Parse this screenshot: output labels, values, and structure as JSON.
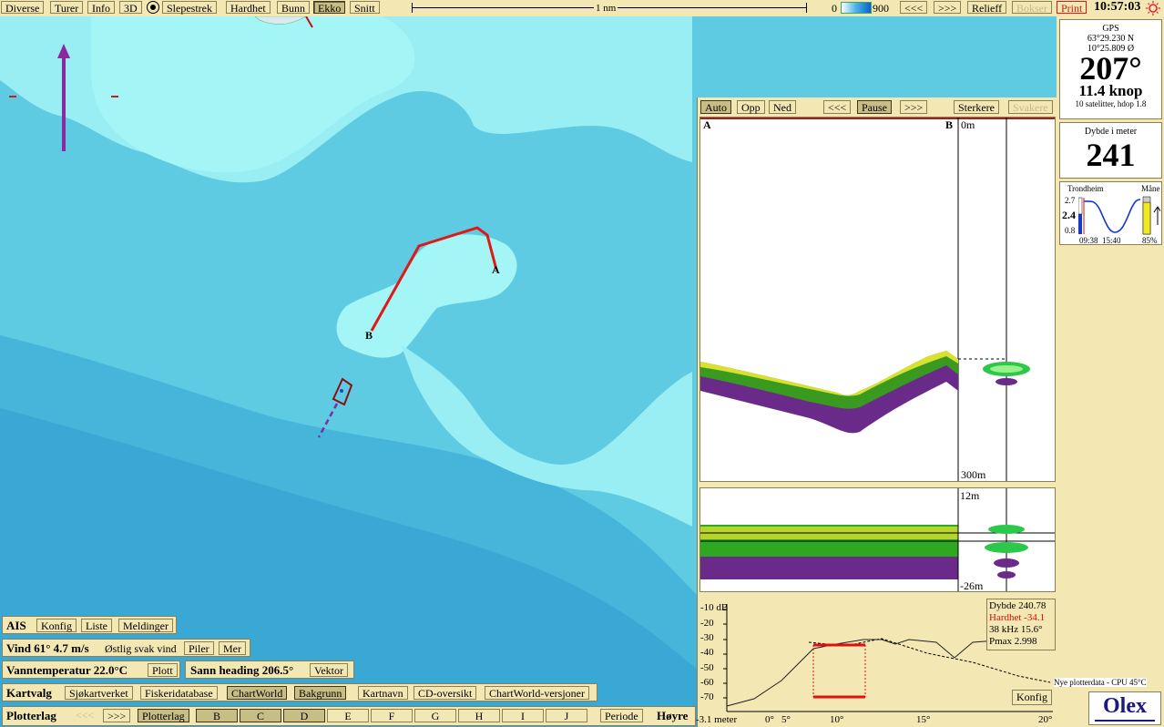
{
  "topbar": {
    "diverse": "Diverse",
    "turer": "Turer",
    "info": "Info",
    "d3": "3D",
    "slepestrek": "Slepestrek",
    "hardhet": "Hardhet",
    "bunn": "Bunn",
    "ekko": "Ekko",
    "snitt": "Snitt",
    "scale_label": "1 nm",
    "depth_min": "0",
    "depth_max": "900",
    "prev": "<<<",
    "next": ">>>",
    "relieff": "Relieff",
    "bokser": "Bokser",
    "print": "Print",
    "clock": "10:57:03"
  },
  "gps": {
    "title": "GPS",
    "lat": "63°29.230 N",
    "lon": "10°25.809 Ø",
    "heading": "207°",
    "speed": "11.4 knop",
    "sats": "10 satelitter, hdop 1.8"
  },
  "depth": {
    "title": "Dybde i meter",
    "value": "241"
  },
  "tide": {
    "place": "Trondheim",
    "moon_label": "Måne",
    "high": "2.7",
    "current": "2.4",
    "low": "0.8",
    "time1": "09:38",
    "time2": "15:40",
    "moon_pct": "85%",
    "moon_level": 0.85
  },
  "echo": {
    "buttons": {
      "auto": "Auto",
      "opp": "Opp",
      "ned": "Ned",
      "prev": "<<<",
      "pause": "Pause",
      "next": ">>>",
      "sterkere": "Sterkere",
      "svakere": "Svakere"
    },
    "label_a": "A",
    "label_b": "B",
    "top_depth": "0m",
    "bottom_depth": "300m",
    "zoom_top": "12m",
    "zoom_bottom": "-26m",
    "info": {
      "dybde": "Dybde 240.78",
      "hardhet": "Hardhet -34.1",
      "freq": "38 kHz 15.6°",
      "pmax": "Pmax 2.998"
    },
    "db_ticks": [
      "-10 dB",
      "-20",
      "-30",
      "-40",
      "-50",
      "-60",
      "-70"
    ],
    "x_ticks": [
      "-3.1 meter",
      "0°",
      "5°",
      "10°",
      "15°",
      "20°"
    ],
    "konfig": "Konfig"
  },
  "map": {
    "label_a": "A",
    "label_b": "B"
  },
  "status": "Nye plotterdata - CPU 45°C",
  "logo": "Olex",
  "ais": {
    "label": "AIS",
    "konfig": "Konfig",
    "liste": "Liste",
    "meldinger": "Meldinger"
  },
  "wind": {
    "label": "Vind 61° 4.7 m/s",
    "desc": "Østlig svak vind",
    "piler": "Piler",
    "mer": "Mer"
  },
  "water": {
    "label": "Vanntemperatur 22.0°C",
    "plott": "Plott"
  },
  "heading": {
    "label": "Sann heading 206.5°",
    "vektor": "Vektor"
  },
  "kartvalg": {
    "label": "Kartvalg",
    "sjokart": "Sjøkartverket",
    "fiskeri": "Fiskeridatabase",
    "chartworld": "ChartWorld",
    "bakgrunn": "Bakgrunn",
    "kartnavn": "Kartnavn",
    "cdoversikt": "CD-oversikt",
    "cwversjoner": "ChartWorld-versjoner"
  },
  "plotterlag": {
    "label": "Plotterlag",
    "prev": "<<<",
    "next": ">>>",
    "plotterlag": "Plotterlag",
    "layers": [
      "B",
      "C",
      "D",
      "E",
      "F",
      "G",
      "H",
      "I",
      "J"
    ],
    "periode": "Periode",
    "hoyre": "Høyre"
  }
}
